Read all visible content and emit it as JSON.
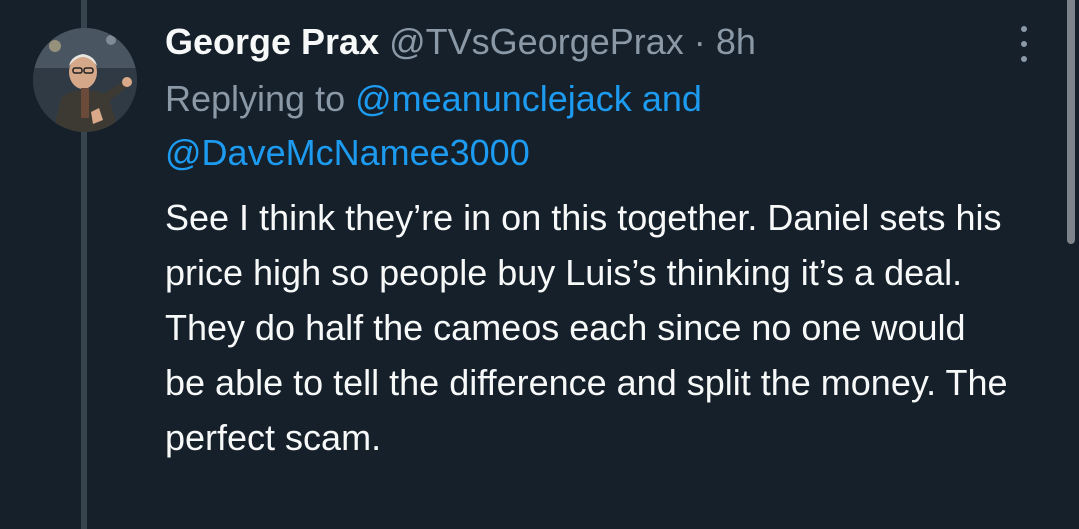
{
  "tweet": {
    "display_name": "George Prax",
    "handle": "@TVsGeorgePrax",
    "separator": "·",
    "time": "8h",
    "replying_prefix": "Replying to",
    "mention_1": "@meanunclejack",
    "mention_joiner": "and",
    "mention_2": "@DaveMcNamee3000",
    "body": "See I think they’re in on this together. Daniel sets his price high so people buy Luis’s thinking it’s a deal. They do half the cameos each since no one would be able to tell the difference and split the money. The perfect scam."
  },
  "icons": {
    "more": "more-vertical-icon"
  },
  "colors": {
    "background": "#15202b",
    "text_primary": "#f7f9f9",
    "text_secondary": "#8b98a5",
    "link": "#1d9bf0",
    "thread_line": "#38444d"
  }
}
